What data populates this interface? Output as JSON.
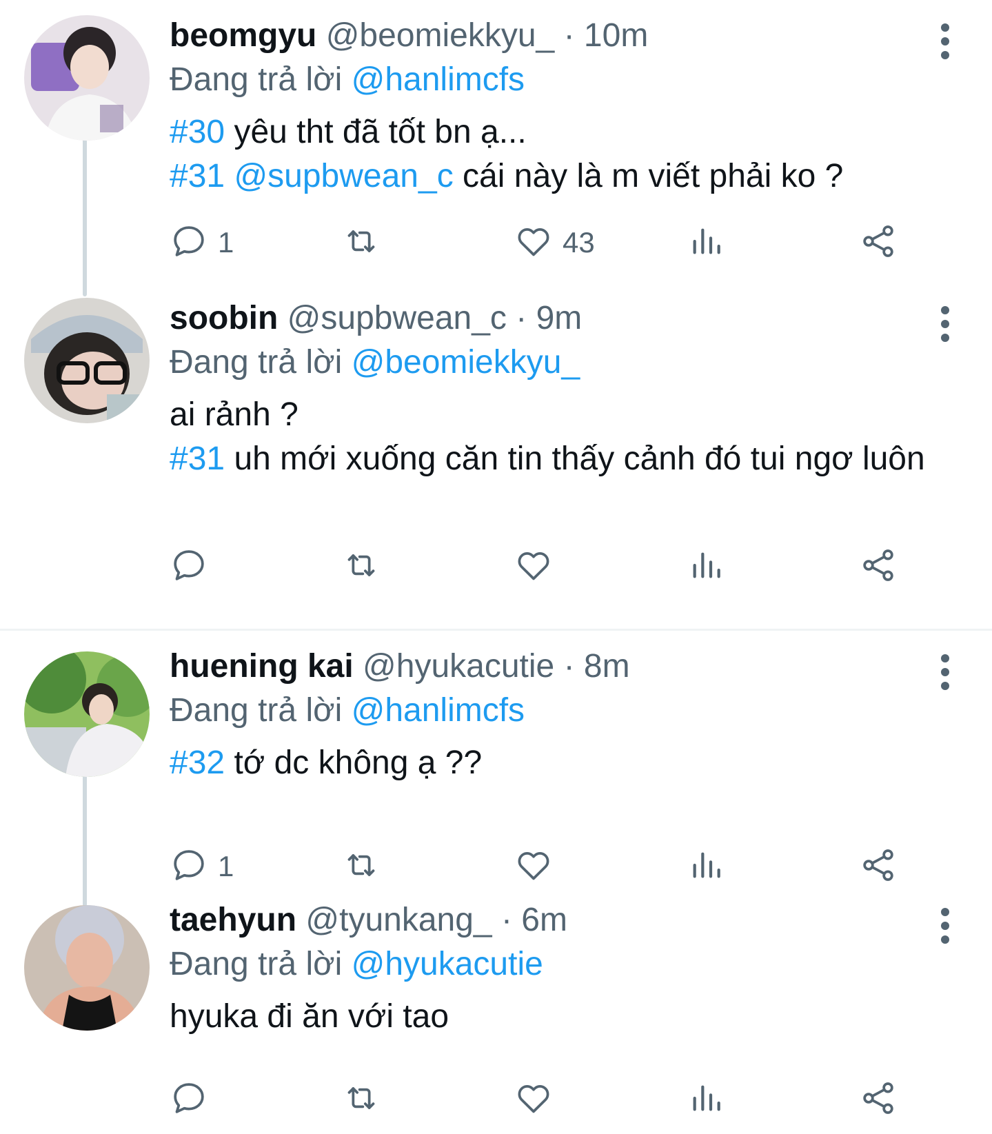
{
  "tweets": [
    {
      "name": "beomgyu",
      "handle": "@beomiekkyu_",
      "separator": "·",
      "time": "10m",
      "replying_prefix": "Đang trả lời",
      "replying_to": "@hanlimcfs",
      "lines": [
        {
          "tag": "#30",
          "mention": "",
          "text": "yêu tht đã tốt bn ạ..."
        },
        {
          "tag": "#31",
          "mention": "@supbwean_c",
          "text": "cái này là m viết phải ko ?"
        }
      ],
      "reply_count": "1",
      "retweet_count": "",
      "like_count": "43"
    },
    {
      "name": "soobin",
      "handle": "@supbwean_c",
      "separator": "·",
      "time": "9m",
      "replying_prefix": "Đang trả lời",
      "replying_to": "@beomiekkyu_",
      "plain_first": "ai rảnh ?",
      "lines": [
        {
          "tag": "#31",
          "mention": "",
          "text": "uh mới xuống căn tin thấy cảnh đó tui ngơ luôn"
        }
      ],
      "reply_count": "",
      "retweet_count": "",
      "like_count": ""
    },
    {
      "name": "huening kai",
      "handle": "@hyukacutie",
      "separator": "·",
      "time": "8m",
      "replying_prefix": "Đang trả lời",
      "replying_to": "@hanlimcfs",
      "lines": [
        {
          "tag": "#32",
          "mention": "",
          "text": "tớ dc không ạ ??"
        }
      ],
      "reply_count": "1",
      "retweet_count": "",
      "like_count": ""
    },
    {
      "name": "taehyun",
      "handle": "@tyunkang_",
      "separator": "·",
      "time": "6m",
      "replying_prefix": "Đang trả lời",
      "replying_to": "@hyukacutie",
      "plain_first": "hyuka đi ăn với tao",
      "lines": [],
      "reply_count": "",
      "retweet_count": "",
      "like_count": ""
    }
  ],
  "icons": {
    "reply": "reply-icon",
    "retweet": "retweet-icon",
    "like": "like-icon",
    "views": "views-icon",
    "share": "share-icon",
    "more": "more-icon"
  },
  "colors": {
    "link": "#1d9bf0",
    "secondary_text": "#536471",
    "thread_line": "#cfd9de"
  }
}
